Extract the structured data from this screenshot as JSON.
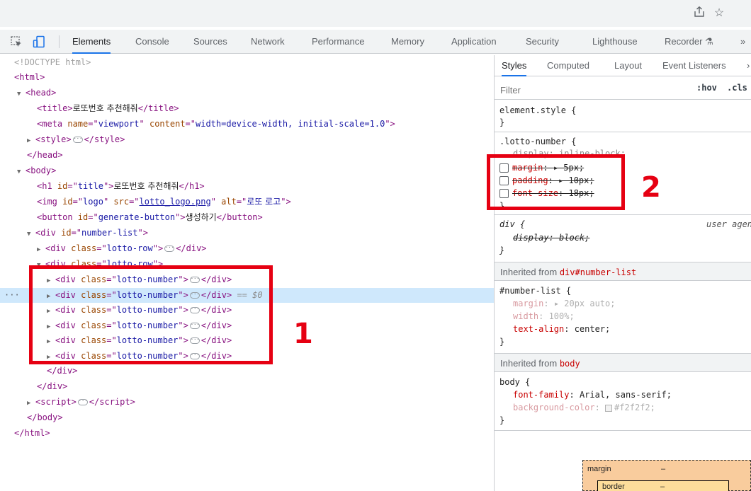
{
  "browser": {
    "icons": [
      "share-icon",
      "star-icon"
    ]
  },
  "devtools": {
    "tabs": [
      "Elements",
      "Console",
      "Sources",
      "Network",
      "Performance",
      "Memory",
      "Application",
      "Security",
      "Lighthouse",
      "Recorder",
      "»"
    ],
    "active_tab": "Elements"
  },
  "dom": {
    "doctype": "<!DOCTYPE html>",
    "html_open": "<html>",
    "head_open": "<head>",
    "title_text": "로또번호 추천해줘",
    "meta_name": "viewport",
    "meta_content": "width=device-width, initial-scale=1.0",
    "head_close": "</head>",
    "body_open": "<body>",
    "h1_id": "title",
    "h1_text": "로또번호 추천해줘",
    "img_id": "logo",
    "img_src": "lotto_logo.png",
    "img_alt": "로또 로고",
    "button_id": "generate-button",
    "button_text": "생성하기",
    "div_id": "number-list",
    "row_class": "lotto-row",
    "number_class": "lotto-number",
    "selected_marker": "== $0",
    "row_count": 6,
    "selected_index": 1,
    "body_close": "</body>",
    "html_close": "</html>"
  },
  "styles_pane": {
    "subtabs": [
      "Styles",
      "Computed",
      "Layout",
      "Event Listeners",
      "›"
    ],
    "active_subtab": "Styles",
    "filter_placeholder": "Filter",
    "hov": ":hov",
    "cls": ".cls",
    "element_style": "element.style {",
    "close_brace": "}",
    "lotto_selector": ".lotto-number {",
    "lotto_display": "display: inline-block;",
    "lotto_margin_prop": "margin",
    "lotto_margin_val": "▸ 5px;",
    "lotto_padding_prop": "padding",
    "lotto_padding_val": "▸ 10px;",
    "lotto_fontsize_prop": "font-size",
    "lotto_fontsize_val": "18px;",
    "div_selector": "div {",
    "div_origin": "user agent stylesheet",
    "div_display": "display: block;",
    "inherited_label": "Inherited from",
    "inherited_1": "div#number-list",
    "numlist_selector": "#number-list {",
    "numlist_margin": "▸ 20px auto;",
    "numlist_width": "100%;",
    "numlist_textalign": "center;",
    "inherited_2": "body",
    "body_selector": "body {",
    "body_fontfamily": "Arial, sans-serif;",
    "body_bg": "#f2f2f2;",
    "boxmodel_margin": "margin",
    "boxmodel_border": "border",
    "boxmodel_dash": "–"
  },
  "annotations": {
    "label_1": "1",
    "label_2": "2",
    "color": "#e60012"
  }
}
